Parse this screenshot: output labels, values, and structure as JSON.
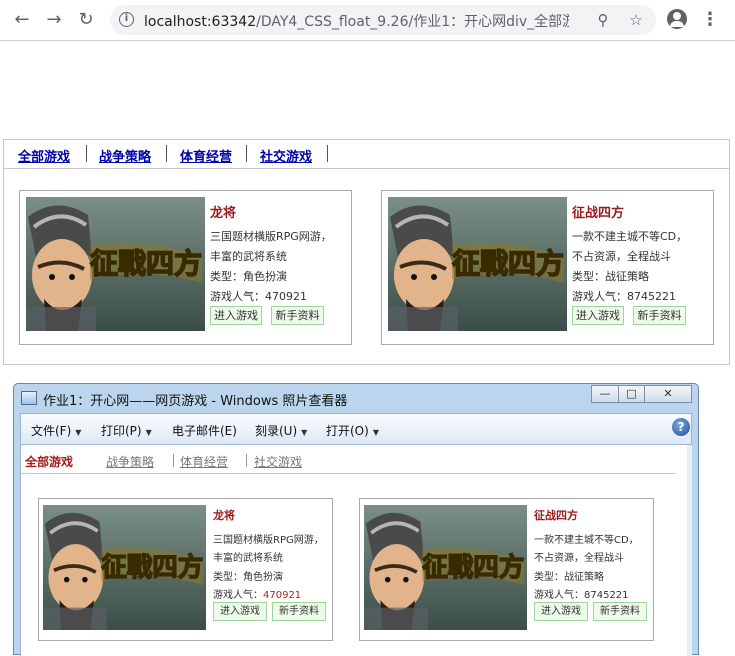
{
  "browser": {
    "url_host": "localhost:63342",
    "url_path": "/DAY4_CSS_float_9.26/作业1：开心网div_全部游..."
  },
  "page": {
    "tabs": [
      "全部游戏",
      "战争策略",
      "体育经营",
      "社交游戏"
    ],
    "cards": [
      {
        "image_alt": "征戰四方",
        "title": "龙将",
        "desc_line1": "三国题材横版RPG网游，",
        "desc_line2": "丰富的武将系统",
        "type": "类型：角色扮演",
        "popularity": "游戏人气：470921",
        "enter_button": "进入游戏",
        "guide_button": "新手资料"
      },
      {
        "image_alt": "征戰四方",
        "title": "征战四方",
        "desc_line1": "一款不建主城不等CD，",
        "desc_line2": "不占资源，全程战斗",
        "type": "类型：战征策略",
        "popularity": "游戏人气：8745221",
        "enter_button": "进入游戏",
        "guide_button": "新手资料"
      }
    ]
  },
  "viewer": {
    "window_title": "作业1：开心网——网页游戏 - Windows 照片查看器",
    "menu": [
      "文件(F)",
      "打印(P)",
      "电子邮件(E)",
      "刻录(U)",
      "打开(O)"
    ],
    "menu_carets": [
      true,
      true,
      false,
      true,
      true
    ],
    "tabs": [
      "全部游戏",
      "战争策略",
      "体育经营",
      "社交游戏"
    ],
    "cards": [
      {
        "title": "龙将",
        "desc_line1": "三国题材横版RPG网游，",
        "desc_line2": "丰富的武将系统",
        "type": "类型：角色扮演",
        "popularity_label": "游戏人气：",
        "popularity_value": "470921",
        "enter_button": "进入游戏",
        "guide_button": "新手资料"
      },
      {
        "title": "征战四方",
        "desc_line1": "一款不建主城不等CD，",
        "desc_line2": "不占资源，全程战斗",
        "type": "类型：战征策略",
        "popularity_label": "游戏人气：",
        "popularity_value": "8745221",
        "enter_button": "进入游戏",
        "guide_button": "新手资料"
      }
    ]
  },
  "colors": {
    "title_red": "#9b1b1b",
    "link_blue": "#0000a8",
    "button_green_border": "#9fd49f",
    "button_green_bg": "#edfbe9"
  },
  "icons": [
    "back-arrow-icon",
    "forward-arrow-icon",
    "reload-icon",
    "info-icon",
    "zoom-icon",
    "star-icon",
    "account-icon",
    "more-menu-icon",
    "photo-viewer-app-icon",
    "help-icon"
  ]
}
